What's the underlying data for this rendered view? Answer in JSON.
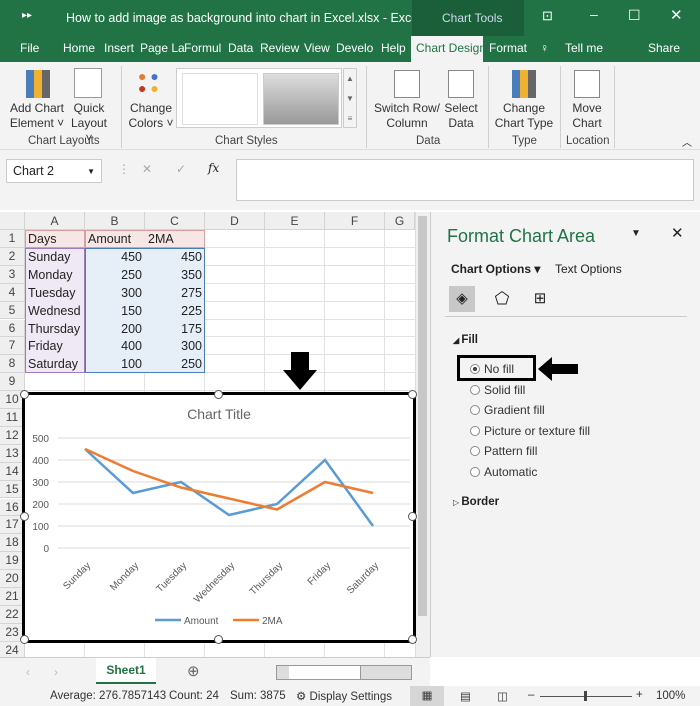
{
  "title": "How to add image as background into chart in Excel.xlsx  -  Excel",
  "context_tab": "Chart Tools",
  "tabs": [
    "File",
    "Home",
    "Insert",
    "Page La",
    "Formul",
    "Data",
    "Review",
    "View",
    "Develo",
    "Help",
    "Chart Design",
    "Format",
    "Tell me",
    "Share"
  ],
  "ribbon": {
    "add_chart": "Add Chart",
    "add_chart2": "Element",
    "quick": "Quick",
    "quick2": "Layout",
    "change": "Change",
    "colors": "Colors",
    "switch": "Switch Row/",
    "switch2": "Column",
    "select": "Select",
    "select2": "Data",
    "cct": "Change",
    "cct2": "Chart Type",
    "move": "Move",
    "move2": "Chart",
    "groups": [
      "Chart Layouts",
      "Chart Styles",
      "Data",
      "Type",
      "Location"
    ]
  },
  "namebox": "Chart 2",
  "fx": "fx",
  "columns": [
    "A",
    "B",
    "C",
    "D",
    "E",
    "F",
    "G"
  ],
  "rows": [
    "1",
    "2",
    "3",
    "4",
    "5",
    "6",
    "7",
    "8",
    "9",
    "10",
    "11",
    "12",
    "13",
    "14",
    "15",
    "16",
    "17",
    "18",
    "19",
    "20",
    "21",
    "22",
    "23",
    "24"
  ],
  "table": {
    "headers": [
      "Days",
      "Amount",
      "2MA"
    ],
    "data": [
      [
        "Sunday",
        "450",
        "450"
      ],
      [
        "Monday",
        "250",
        "350"
      ],
      [
        "Tuesday",
        "300",
        "275"
      ],
      [
        "Wednesd",
        "150",
        "225"
      ],
      [
        "Thursday",
        "200",
        "175"
      ],
      [
        "Friday",
        "400",
        "300"
      ],
      [
        "Saturday",
        "100",
        "250"
      ]
    ]
  },
  "chart_data": {
    "type": "line",
    "title": "Chart Title",
    "categories": [
      "Sunday",
      "Monday",
      "Tuesday",
      "Wednesday",
      "Thursday",
      "Friday",
      "Saturday"
    ],
    "series": [
      {
        "name": "Amount",
        "color": "#5b9bd5",
        "values": [
          450,
          250,
          300,
          150,
          200,
          400,
          100
        ]
      },
      {
        "name": "2MA",
        "color": "#ed7d31",
        "values": [
          450,
          350,
          275,
          225,
          175,
          300,
          250
        ]
      }
    ],
    "yticks": [
      "0",
      "100",
      "200",
      "300",
      "400",
      "500"
    ],
    "ylim": [
      0,
      500
    ],
    "legend": "bottom"
  },
  "pane": {
    "title": "Format Chart Area",
    "chart_options": "Chart Options",
    "text_options": "Text Options",
    "fill": "Fill",
    "options": [
      "No fill",
      "Solid fill",
      "Gradient fill",
      "Picture or texture fill",
      "Pattern fill",
      "Automatic"
    ],
    "selected": 0,
    "border": "Border"
  },
  "sheet_tab": "Sheet1",
  "status": {
    "average": "Average: 276.7857143",
    "count": "Count: 24",
    "sum": "Sum: 3875",
    "display": "Display Settings",
    "zoom": "100%"
  }
}
